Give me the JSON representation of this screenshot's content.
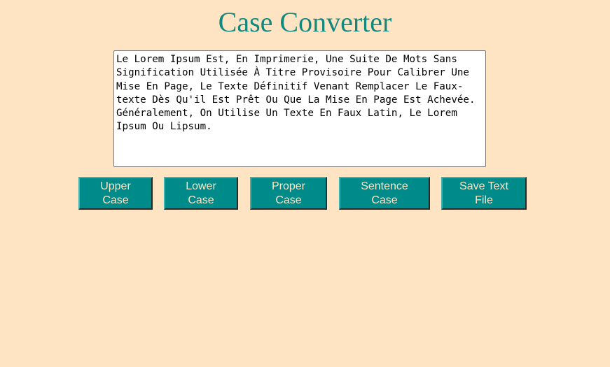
{
  "title": "Case Converter",
  "textarea": {
    "value": "Le Lorem Ipsum Est, En Imprimerie, Une Suite De Mots Sans Signification Utilisée À Titre Provisoire Pour Calibrer Une Mise En Page, Le Texte Définitif Venant Remplacer Le Faux-texte Dès Qu'il Est Prêt Ou Que La Mise En Page Est Achevée. Généralement, On Utilise Un Texte En Faux Latin, Le Lorem Ipsum Ou Lipsum."
  },
  "buttons": {
    "upper": {
      "line1": "Upper",
      "line2": "Case"
    },
    "lower": {
      "line1": "Lower",
      "line2": "Case"
    },
    "proper": {
      "line1": "Proper",
      "line2": "Case"
    },
    "sentence": {
      "line1": "Sentence",
      "line2": "Case"
    },
    "save": {
      "line1": "Save Text",
      "line2": "File"
    }
  },
  "colors": {
    "background": "#ffe4c4",
    "title": "#12897f",
    "button_bg": "#008b8b",
    "button_text": "#ffe4c4"
  }
}
